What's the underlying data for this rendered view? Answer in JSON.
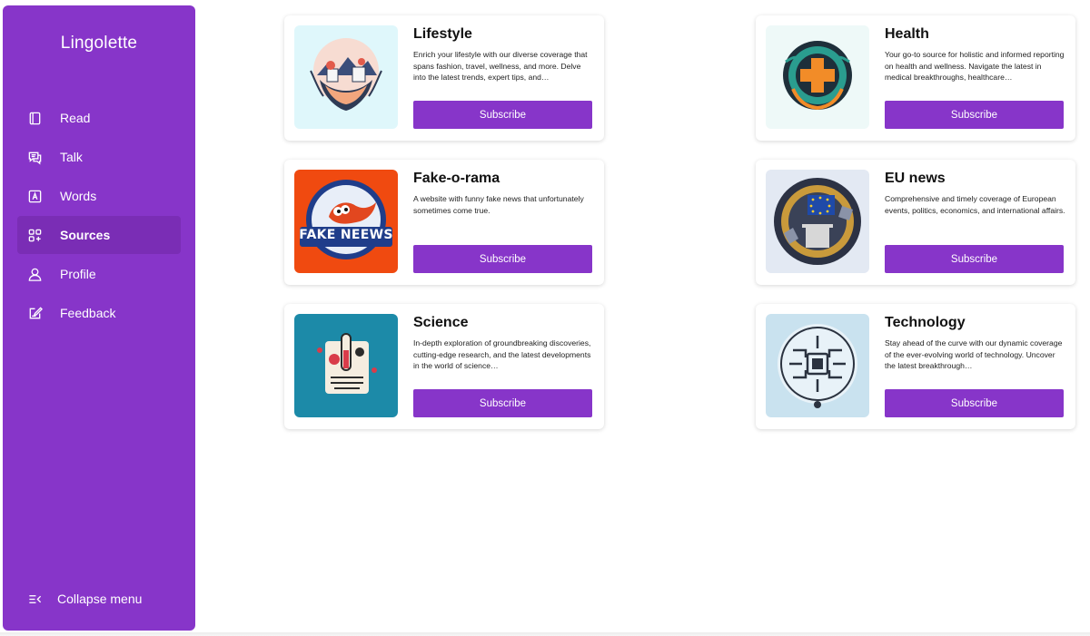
{
  "sidebar": {
    "brand": "Lingolette",
    "items": [
      {
        "label": "Read",
        "icon": "book-icon"
      },
      {
        "label": "Talk",
        "icon": "chat-icon"
      },
      {
        "label": "Words",
        "icon": "letter-a-icon"
      },
      {
        "label": "Sources",
        "icon": "grid-plus-icon",
        "active": true
      },
      {
        "label": "Profile",
        "icon": "person-icon"
      },
      {
        "label": "Feedback",
        "icon": "feedback-icon"
      }
    ],
    "collapse_label": "Collapse menu"
  },
  "sources": [
    {
      "title": "Lifestyle",
      "description": "Enrich your lifestyle with our diverse coverage that spans fashion, travel, wellness, and more. Delve into the latest trends, expert tips, and…",
      "button": "Subscribe"
    },
    {
      "title": "Health",
      "description": "Your go-to source for holistic and informed reporting on health and wellness. Navigate the latest in medical breakthroughs, healthcare…",
      "button": "Subscribe"
    },
    {
      "title": "Fake-o-rama",
      "description": "A website with funny fake news that unfortunately sometimes come true.",
      "button": "Subscribe",
      "logo_text": "FAKE NEEWS"
    },
    {
      "title": "EU news",
      "description": "Comprehensive and timely coverage of European events, politics, economics, and international affairs.",
      "button": "Subscribe"
    },
    {
      "title": "Science",
      "description": "In-depth exploration of groundbreaking discoveries, cutting-edge research, and the latest developments in the world of science…",
      "button": "Subscribe"
    },
    {
      "title": "Technology",
      "description": "Stay ahead of the curve with our dynamic coverage of the ever-evolving world of technology. Uncover the latest breakthrough…",
      "button": "Subscribe"
    }
  ],
  "colors": {
    "accent": "#8735c9",
    "accent_active": "#7a2db5"
  }
}
